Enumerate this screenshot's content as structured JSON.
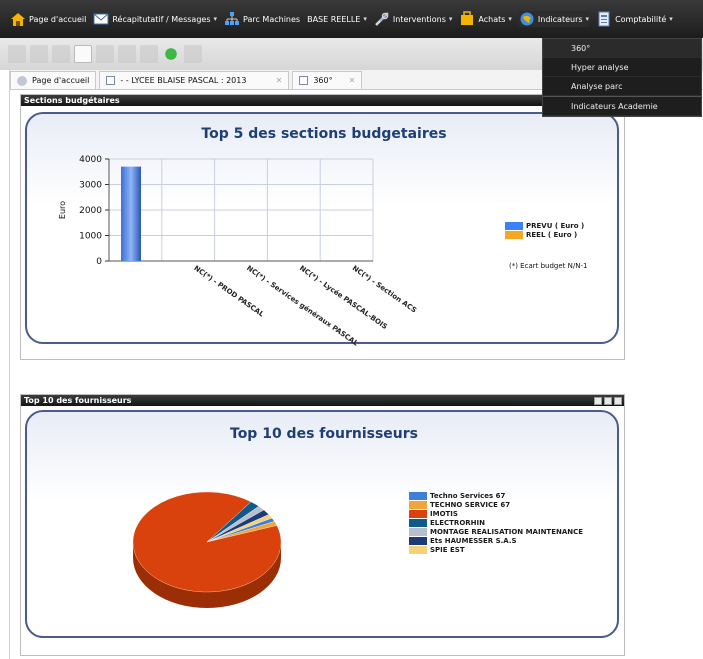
{
  "menubar": {
    "items": [
      {
        "label": "Page d'accueil",
        "icon": "home-icon",
        "caret": false
      },
      {
        "label": "Récapitutatif / Messages",
        "icon": "mail-icon",
        "caret": true
      },
      {
        "label": "Parc Machines",
        "icon": "network-icon",
        "caret": false
      },
      {
        "label": "BASE REELLE",
        "icon": "",
        "caret": true
      },
      {
        "label": "Interventions",
        "icon": "tools-icon",
        "caret": true
      },
      {
        "label": "Achats",
        "icon": "cart-icon",
        "caret": true
      },
      {
        "label": "Indicateurs",
        "icon": "globe-icon",
        "caret": true
      },
      {
        "label": "Comptabilité",
        "icon": "ledger-icon",
        "caret": true
      }
    ]
  },
  "tabs": [
    {
      "label": "Page d'accueil"
    },
    {
      "label": "- - LYCEE BLAISE PASCAL : 2013"
    },
    {
      "label": "360°"
    }
  ],
  "dropdown": {
    "items": [
      "360°",
      "Hyper analyse",
      "Analyse parc",
      "Indicateurs Academie"
    ]
  },
  "panel1": {
    "title": "Sections budgétaires",
    "chart_title": "Top 5 des sections budgetaires",
    "note": "(*) Ecart budget N/N-1"
  },
  "panel2": {
    "title": "Top 10 des fournisseurs",
    "chart_title": "Top 10 des fournisseurs"
  },
  "chart_data": [
    {
      "type": "bar",
      "title": "Top 5 des sections budgetaires",
      "ylabel": "Euro",
      "ylim": [
        0,
        4000
      ],
      "yticks": [
        0,
        1000,
        2000,
        3000,
        4000
      ],
      "categories": [
        "NC(*) - PROD PASCAL",
        "NC(*) - Services généraux PASCAL",
        "NC(*) - Lycée PASCAL-BOIS",
        "NC(*) - Section ACS"
      ],
      "series": [
        {
          "name": "PREVU ( Euro )",
          "color": "#3b82f6",
          "values": [
            3700,
            0,
            0,
            0
          ]
        },
        {
          "name": "REEL ( Euro )",
          "color": "#f5a623",
          "values": [
            0,
            0,
            0,
            0
          ]
        }
      ],
      "legend": "right"
    },
    {
      "type": "pie",
      "title": "Top 10 des fournisseurs",
      "labels": [
        "Techno Services 67",
        "TECHNO SERVICE 67",
        "IMOTIS",
        "ELECTRORHIN",
        "MONTAGE REALISATION MAINTENANCE",
        "Ets HAUMESSER S.A.S",
        "SPIE EST"
      ],
      "values": [
        1.2,
        1.4,
        90.5,
        2.2,
        1.6,
        1.8,
        1.3
      ],
      "colors": [
        "#3f7fd8",
        "#f2a43a",
        "#d9420c",
        "#0e5a8a",
        "#b8bfcc",
        "#1d3a7a",
        "#f2d37a"
      ],
      "legend": "right"
    }
  ]
}
